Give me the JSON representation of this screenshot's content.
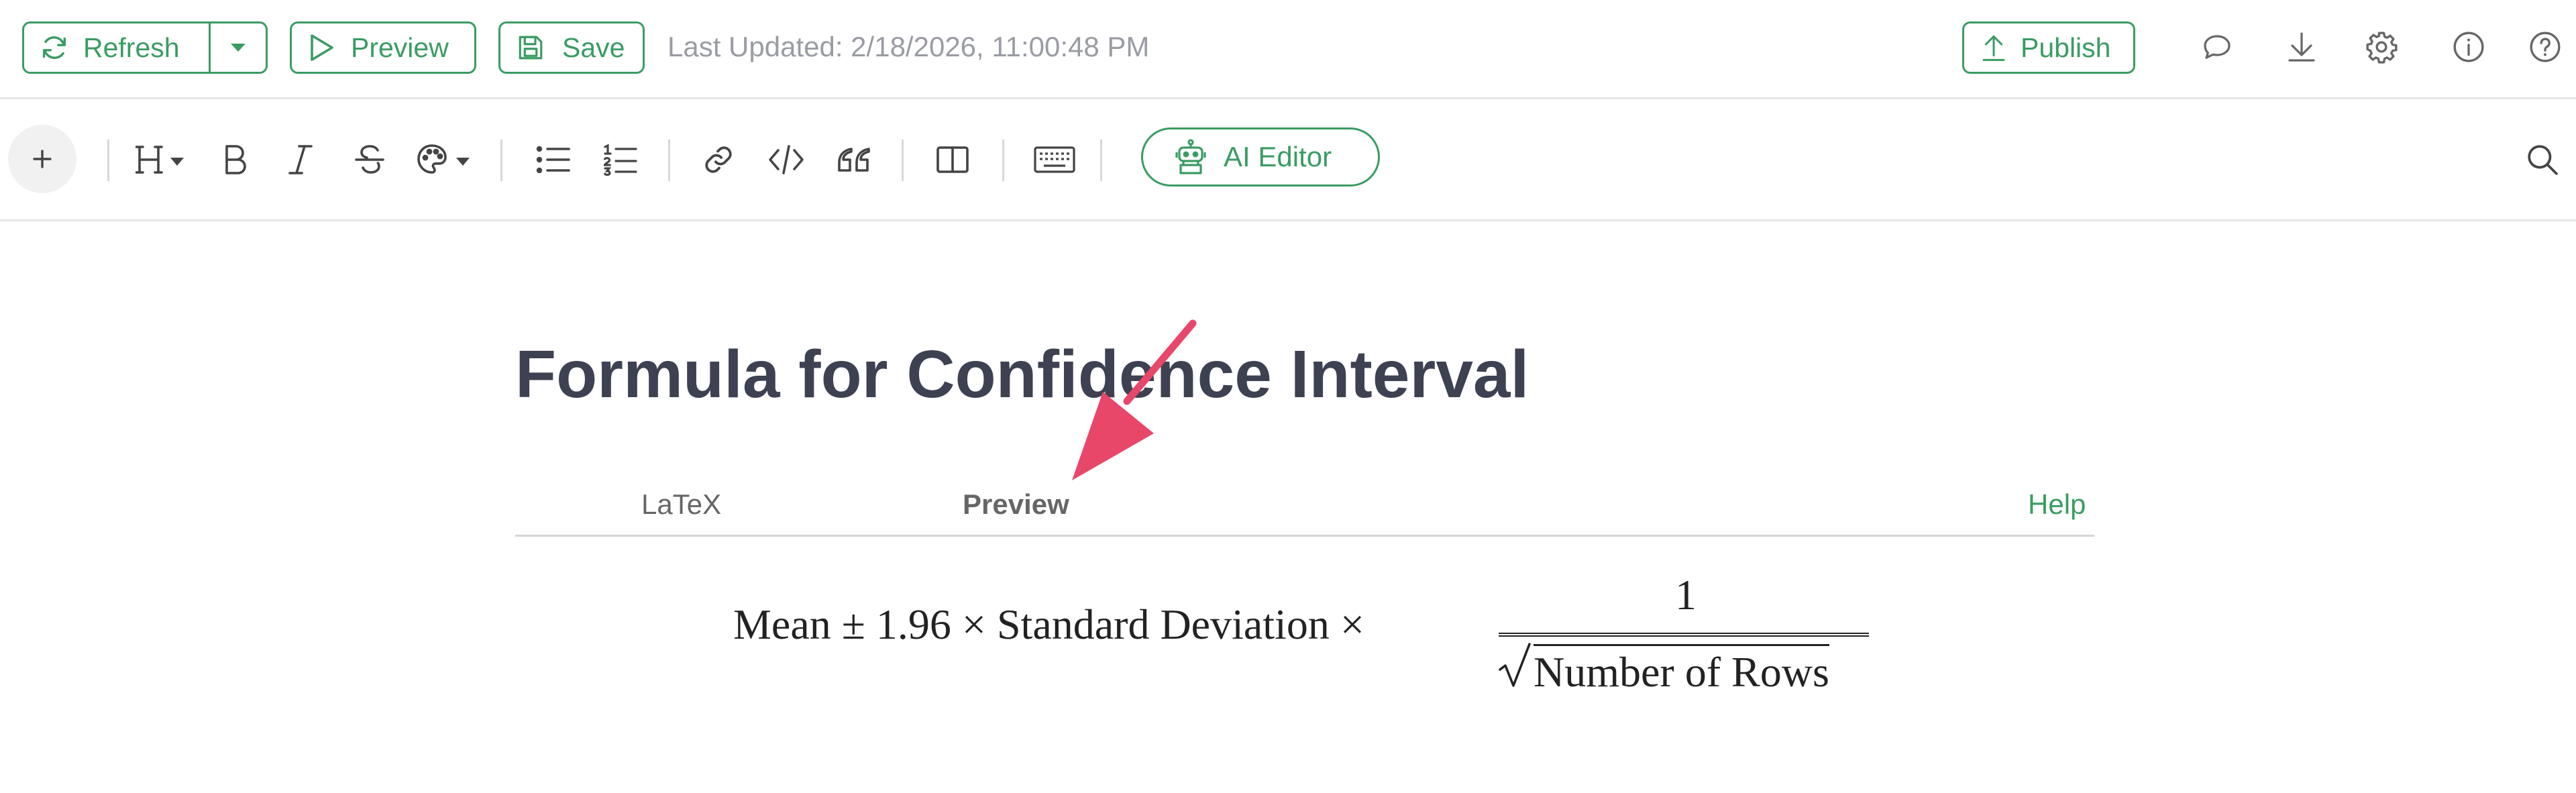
{
  "topbar": {
    "refresh_label": "Refresh",
    "preview_label": "Preview",
    "save_label": "Save",
    "last_updated": "Last Updated: 2/18/2026, 11:00:48 PM",
    "publish_label": "Publish",
    "icons": [
      "comment-icon",
      "download-icon",
      "gear-icon",
      "info-icon",
      "help-icon"
    ]
  },
  "toolbar": {
    "items": [
      "add-icon",
      "heading-icon",
      "bold-icon",
      "italic-icon",
      "strikethrough-icon",
      "palette-icon",
      "bullet-list-icon",
      "numbered-list-icon",
      "link-icon",
      "code-icon",
      "quote-icon",
      "columns-icon",
      "keyboard-icon",
      "robot-icon",
      "search-icon"
    ],
    "ai_editor_label": "AI Editor"
  },
  "document": {
    "title": "Formula for Confidence Interval",
    "tabs": {
      "latex": "LaTeX",
      "preview": "Preview",
      "active": "Preview"
    },
    "help": "Help",
    "formula": {
      "lhs": "Mean ± 1.96 × Standard Deviation ×",
      "numerator": "1",
      "denominator": "Number of Rows"
    }
  },
  "colors": {
    "accent_green": "#3a9c63",
    "title_text": "#3e4152",
    "annotation_arrow": "#e8476a"
  }
}
